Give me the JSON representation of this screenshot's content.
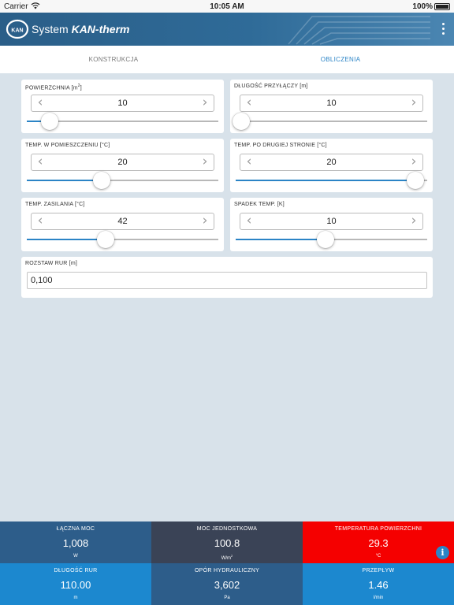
{
  "status": {
    "carrier": "Carrier",
    "time": "10:05 AM",
    "battery": "100%"
  },
  "header": {
    "brand_prefix": "System ",
    "brand_name": "KAN-therm"
  },
  "tabs": [
    {
      "label": "KONSTRUKCJA",
      "active": false
    },
    {
      "label": "OBLICZENIA",
      "active": true
    }
  ],
  "inputs": {
    "powierzchnia": {
      "label_main": "POWIERZCHNIA [m",
      "label_sup": "2",
      "label_end": "]",
      "value": "10",
      "slider_fraction": 0.12
    },
    "dlugosc_przylaczy": {
      "label": "DŁUGOŚĆ PRZYŁĄCZY [m]",
      "value": "10",
      "slider_fraction": 0.03
    },
    "temp_pomieszczenia": {
      "label": "TEMP. W POMIESZCZENIU [°C]",
      "value": "20",
      "slider_fraction": 0.39
    },
    "temp_druga_strona": {
      "label": "TEMP. PO DRUGIEJ STRONIE [°C]",
      "value": "20",
      "slider_fraction": 0.94
    },
    "temp_zasilania": {
      "label": "TEMP. ZASILANIA [°C]",
      "value": "42",
      "slider_fraction": 0.41
    },
    "spadek_temp": {
      "label": "SPADEK TEMP. [K]",
      "value": "10",
      "slider_fraction": 0.47
    },
    "rozstaw_rur": {
      "label": "ROZSTAW RUR [m]",
      "value": "0,100"
    }
  },
  "results": [
    {
      "title": "ŁĄCZNA MOC",
      "value": "1,008",
      "unit": "W",
      "color": "#2d5d8a"
    },
    {
      "title": "MOC JEDNOSTKOWA",
      "value": "100.8",
      "unit_main": "W/m",
      "unit_sup": "2",
      "color": "#3a4356"
    },
    {
      "title": "TEMPERATURA POWIERZCHNI",
      "value": "29.3",
      "unit": "°C",
      "color": "#f50000"
    },
    {
      "title": "DŁUGOŚĆ RUR",
      "value": "110.00",
      "unit": "m",
      "color": "#1c88cf"
    },
    {
      "title": "OPÓR HYDRAULICZNY",
      "value": "3,602",
      "unit": "Pa",
      "color": "#2d5d8a"
    },
    {
      "title": "PRZEPŁYW",
      "value": "1.46",
      "unit": "l/min",
      "color": "#1c88cf"
    }
  ],
  "icons": {
    "info": "i"
  },
  "colors": {
    "accent": "#2b84c6",
    "header": "#2f6b98",
    "background": "#d8e2ea"
  }
}
